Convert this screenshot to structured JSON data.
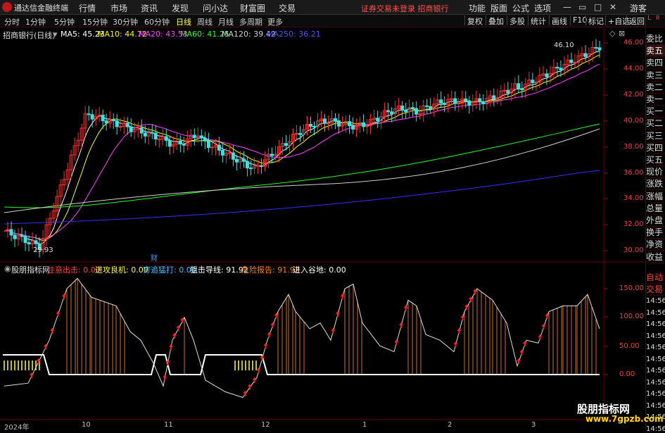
{
  "app": {
    "title": "通达信金融终端"
  },
  "menu": [
    "行情",
    "市场",
    "资讯",
    "发现",
    "问小达",
    "财富圈",
    "交易"
  ],
  "login_status": "证券交易未登录  招商银行",
  "right_menu": [
    "功能",
    "版面",
    "公式",
    "选项"
  ],
  "guest": "游客",
  "toolbar": {
    "periods": [
      "分时",
      "1分钟",
      "5分钟",
      "15分钟",
      "30分钟",
      "60分钟",
      "日线",
      "周线",
      "月线",
      "多周期",
      "更多"
    ],
    "active_period": "日线",
    "buttons": [
      "复权",
      "叠加",
      "多股",
      "统计",
      "画线",
      "F10",
      "标记",
      "+自选",
      "返回"
    ]
  },
  "stock": {
    "label": "招商银行(日线)"
  },
  "ma_legend": [
    {
      "label": "MA5: 45.23",
      "color": "#ffffff"
    },
    {
      "label": "MA10: 44.72",
      "color": "#ffff00"
    },
    {
      "label": "MA20: 43.53",
      "color": "#ff40ff"
    },
    {
      "label": "MA60: 41.25",
      "color": "#20ff20"
    },
    {
      "label": "MA120: 39.42",
      "color": "#d0d0d0"
    },
    {
      "label": "MA250: 36.21",
      "color": "#5050ff"
    }
  ],
  "annotations": {
    "high": "46.10",
    "low": "29.93",
    "fin_marker": "财"
  },
  "price_axis": [
    "46.00",
    "44.00",
    "42.00",
    "40.00",
    "38.00",
    "36.00",
    "34.00",
    "32.00",
    "30.00"
  ],
  "indicator": {
    "name": "股朋指标网",
    "values": [
      {
        "label": "注意出击: 0.00",
        "color": "#ff4040"
      },
      {
        "label": "进攻良机: 0.00",
        "color": "#ffff40"
      },
      {
        "label": "穷追猛打: 0.00",
        "color": "#40c0ff"
      },
      {
        "label": "狙击导线: 91.92",
        "color": "#ffffff"
      },
      {
        "label": "危险报告: 91.92",
        "color": "#ff8000"
      },
      {
        "label": "进入谷地: 0.00",
        "color": "#ffffff"
      }
    ],
    "axis": [
      "150.00",
      "100.00",
      "50.00",
      "0.00"
    ]
  },
  "x_axis": [
    "2024年",
    "10",
    "11",
    "12",
    "1",
    "2",
    "3"
  ],
  "side_panel": {
    "corner": [
      "L",
      "R"
    ],
    "items": [
      {
        "label": "委比",
        "color": "white"
      },
      {
        "label": "卖五",
        "color": "white"
      },
      {
        "label": "卖四",
        "color": "white"
      },
      {
        "label": "卖三",
        "color": "white"
      },
      {
        "label": "卖二",
        "color": "white"
      },
      {
        "label": "卖一",
        "color": "white"
      },
      {
        "label": "买一",
        "color": "white"
      },
      {
        "label": "买二",
        "color": "white"
      },
      {
        "label": "买三",
        "color": "white"
      },
      {
        "label": "买四",
        "color": "white"
      },
      {
        "label": "买五",
        "color": "white"
      },
      {
        "label": "现价",
        "color": "white"
      },
      {
        "label": "涨跌",
        "color": "white"
      },
      {
        "label": "涨幅",
        "color": "white"
      },
      {
        "label": "总量",
        "color": "white"
      },
      {
        "label": "外盘",
        "color": "white"
      },
      {
        "label": "换手",
        "color": "white"
      },
      {
        "label": "净资",
        "color": "white"
      },
      {
        "label": "收益",
        "color": "white"
      }
    ],
    "auto_trade": [
      "自动",
      "交易"
    ],
    "times": [
      "14:56",
      "14:56",
      "14:56",
      "14:56",
      "14:56",
      "14:56",
      "14:56",
      "14:56",
      "14:56",
      "14:56",
      "14:56",
      "14:56"
    ]
  },
  "watermark": {
    "title": "股朋指标网",
    "url": "www.7gpzb.com"
  }
}
